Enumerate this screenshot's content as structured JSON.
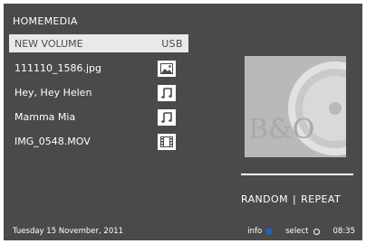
{
  "header": {
    "title": "HOMEMEDIA"
  },
  "list": {
    "selected": {
      "label": "NEW VOLUME",
      "type": "USB"
    },
    "items": [
      {
        "label": "111110_1586.jpg",
        "icon": "image-icon"
      },
      {
        "label": "Hey, Hey Helen",
        "icon": "music-note-icon"
      },
      {
        "label": "Mamma Mia",
        "icon": "music-note-icon"
      },
      {
        "label": "IMG_0548.MOV",
        "icon": "film-icon"
      }
    ]
  },
  "artwork": {
    "logo_text": "B&O"
  },
  "playmodes": {
    "random": "RANDOM",
    "separator": "|",
    "repeat": "REPEAT"
  },
  "footer": {
    "date": "Tuesday 15 November, 2011",
    "info_label": "info",
    "select_label": "select",
    "time": "08:35"
  },
  "colors": {
    "background": "#4a4a4a",
    "highlight": "#e9e9e9",
    "info_dot": "#1d63c7"
  }
}
